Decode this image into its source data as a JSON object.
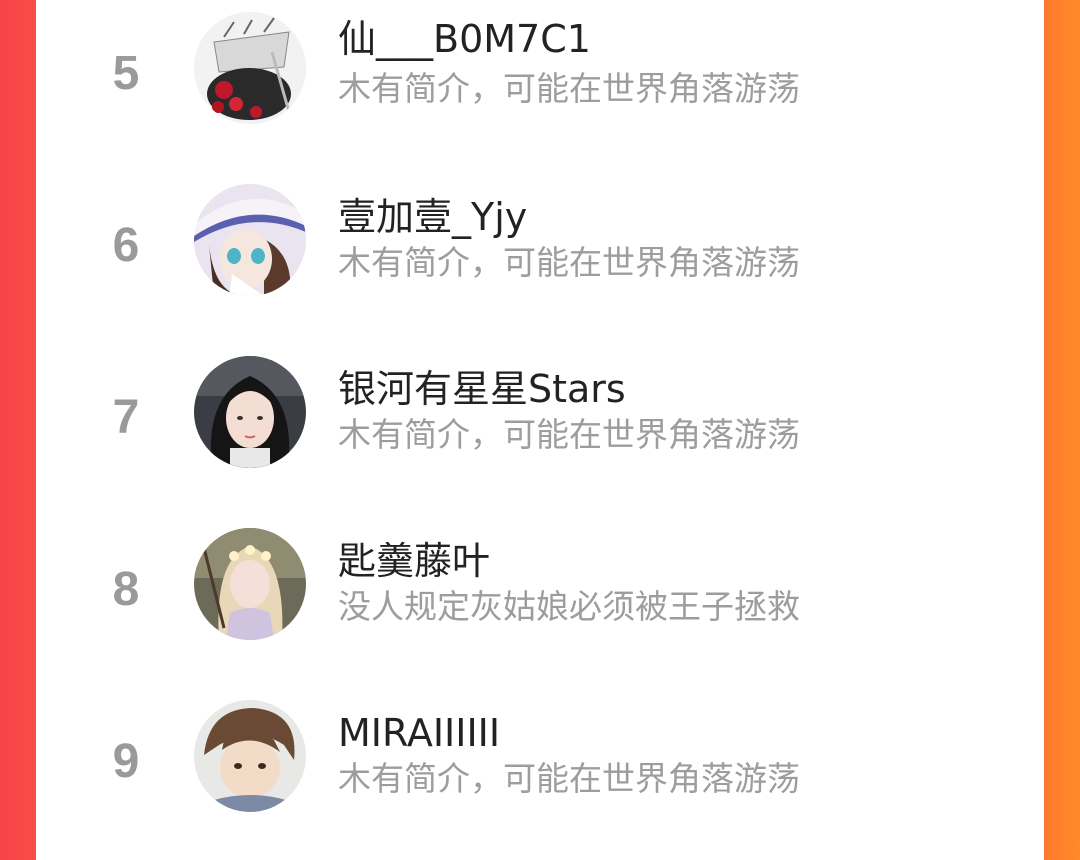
{
  "users": [
    {
      "rank": "5",
      "name": "仙___B0M7C1",
      "bio": "木有简介，可能在世界角落游荡",
      "avatar_icon": "ink-flower-avatar"
    },
    {
      "rank": "6",
      "name": "壹加壹_Yjy",
      "bio": "木有简介，可能在世界角落游荡",
      "avatar_icon": "anime-girl-hat-avatar"
    },
    {
      "rank": "7",
      "name": "银河有星星Stars",
      "bio": "木有简介，可能在世界角落游荡",
      "avatar_icon": "girl-photo-avatar"
    },
    {
      "rank": "8",
      "name": "匙羹藤叶",
      "bio": "没人规定灰姑娘必须被王子拯救",
      "avatar_icon": "fairy-illustration-avatar"
    },
    {
      "rank": "9",
      "name": "MIRAIIIIII",
      "bio": "木有简介，可能在世界角落游荡",
      "avatar_icon": "anime-boy-avatar"
    }
  ],
  "colors": {
    "left_edge": "#f7434a",
    "right_edge": "#ff7a2e",
    "rank": "#9a9a9a",
    "name": "#222222",
    "bio": "#9d9d9d"
  }
}
